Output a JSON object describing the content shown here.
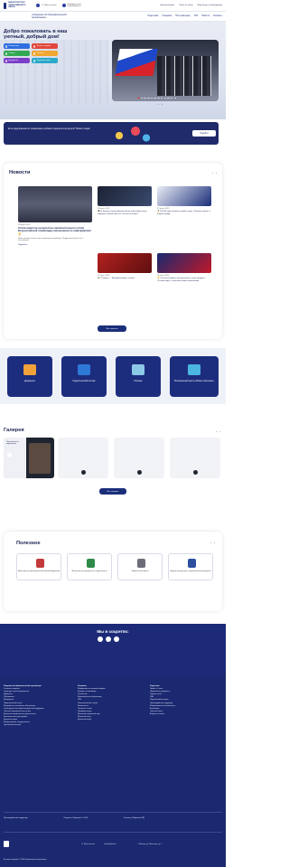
{
  "header": {
    "logo_text": "МИНИСТЕРСТВО ОБРАЗОВАНИЯ И НАУКИ",
    "phone": "+7 (9xx) xx-xx-xx",
    "email_label": "Напишите нам",
    "email": "school@edu.ru",
    "top_links": [
      "Личный кабинет",
      "Поиск по сайту",
      "Версия для слабовидящих"
    ],
    "school_name": "«Сведения об образовательной организации»",
    "nav": [
      "Родителям",
      "Учащимся",
      "Поступающему",
      "ГИА",
      "Новости",
      "Контакты"
    ]
  },
  "hero": {
    "title": "Добро пожаловать в наш уютный, добрый дом!",
    "buttons": [
      {
        "label": "Расписание",
        "color": "#2f6ee0"
      },
      {
        "label": "Запись в кружки",
        "color": "#e2473d"
      },
      {
        "label": "Секции",
        "color": "#32a852"
      },
      {
        "label": "Питание",
        "color": "#f0a630"
      },
      {
        "label": "Документы",
        "color": "#7b3fc9"
      },
      {
        "label": "Обратная связь",
        "color": "#2aa9c9"
      }
    ],
    "slider_prev": "‹",
    "slider_next": "›"
  },
  "banner": {
    "text": "Есть предложения по организации учебного процесса или досуга? Пишите сюда!",
    "button": "Перейти"
  },
  "news": {
    "title": "Новости",
    "main": {
      "date": "28 марта 2024",
      "title": "Стали известны результаты заключительного этапа Всероссийской олимпиады школьников по информатике! 🏆",
      "text": "Наши ученики вошли в число призёров олимпиады. Поздравляем ребят и их наставников!",
      "more": "Подробнее"
    },
    "cards": [
      {
        "date": "28 марта 2024",
        "title": "🎓 В Финале всероссийской школы-практикума юных лидеров «Лучше вместе» состоялся выпуск"
      },
      {
        "date": "27 марта 2024",
        "title": "🏅 В 2023 году появился новый статус «Лучшая школа» в нашем городе"
      },
      {
        "date": "27 марта 2024",
        "title": "🎭 27 марта — Всемирный день театра!"
      },
      {
        "date": "26 марта 2024",
        "title": "🏆 Состоялся финал регионального этапа конкурса «Ученик года» с участием наших школьников"
      }
    ],
    "all_button": "Все новости"
  },
  "tiles": [
    {
      "label": "Документы",
      "ico_color": "#f2a23a"
    },
    {
      "label": "Педагогический состав",
      "ico_color": "#2f79d6"
    },
    {
      "label": "Питание",
      "ico_color": "#8cc9e8"
    },
    {
      "label": "Региональный центр «Новое поколение»",
      "ico_color": "#4bb6e0"
    }
  ],
  "gallery": {
    "title": "Галерея",
    "card_caption": "Познавательная видеолекция",
    "all_button": "Вся галерея"
  },
  "useful": {
    "title": "Полезное",
    "links": [
      {
        "label": "Министерство просвещения Российской Федерации",
        "emb": "#c23a3a"
      },
      {
        "label": "Министерство образования и науки области",
        "emb": "#2f8a4a"
      },
      {
        "label": "Федеральный портал",
        "emb": "#6b6e7a"
      },
      {
        "label": "Единое окно доступа к образовательным ресурсам",
        "emb": "#2c4fa0"
      }
    ]
  },
  "social": {
    "title": "Мы в соцсетях:"
  },
  "footer": {
    "col1": [
      "Сведения об образовательной организации",
      "Основные сведения",
      "Структура и органы управления",
      "Документы",
      "Образование",
      "Руководство",
      "Педагогический состав",
      "Материально-техническое обеспечение",
      "Стипендии и иные виды материальной поддержки",
      "Платные образовательные услуги",
      "Финансово-хозяйственная деятельность",
      "Вакантные места для приёма",
      "Доступная среда",
      "Международное сотрудничество",
      "Организация питания"
    ],
    "col2": [
      "Учащимся",
      "Информация по правилам приёма",
      "Конкурсы и олимпиады",
      "Расписание",
      "Дополнительное образование",
      "ГИА",
      "Психологическая служба",
      "Безопасность",
      "Полезные ссылки",
      "Профориентация",
      "Школьный спортивный клуб",
      "Школьный театр",
      "Школьный музей"
    ],
    "col3": [
      "Родителям",
      "Приём в 1 класс",
      "Нормативные документы",
      "Горячая линия",
      "ГИА",
      "Родительский контроль",
      "Противодействие коррупции",
      "Информационная безопасность",
      "Антитеррор",
      "Обратная связь",
      "Вопросы и ответы"
    ],
    "bottom_left": "Противодействие коррупции",
    "bottom_mid": "Подписка «Зарядка» с 10:00",
    "bottom_right": "Контакты (Подписка ПД)",
    "phone": "+7 (9xx) xx-xx-xx",
    "email": "school@edu.ru",
    "address": "г. Москва, ул. Школьная, д. 1",
    "copyright": "Все права защищены © 2024 Образовательная организация"
  }
}
